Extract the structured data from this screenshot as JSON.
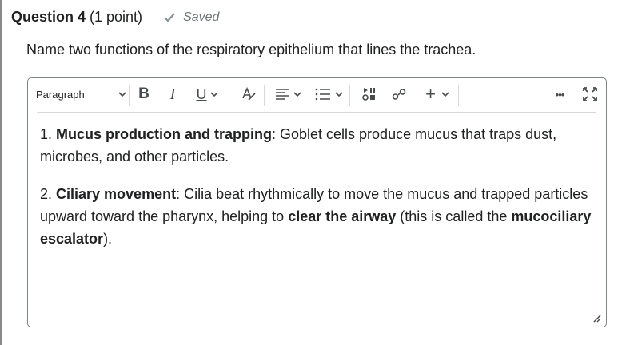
{
  "question": {
    "title": "Question 4",
    "points": "(1 point)",
    "status": "Saved",
    "prompt": "Name two functions of the respiratory epithelium that lines the trachea."
  },
  "toolbar": {
    "format_label": "Paragraph",
    "bold_label": "B",
    "italic_label": "I",
    "underline_label": "U",
    "insert_label": "+",
    "more_label": "•••",
    "icons": [
      "checkmark-icon",
      "chevron-down-icon",
      "text-color-icon",
      "align-icon",
      "list-icon",
      "media-icon",
      "link-icon",
      "plus-icon",
      "more-icon",
      "fullscreen-icon",
      "resize-handle-icon"
    ]
  },
  "answer": {
    "p1_number": "1. ",
    "p1_bold": "Mucus production and trapping",
    "p1_rest": ": Goblet cells produce mucus that traps dust, microbes, and other particles.",
    "p2_number": "2. ",
    "p2_bold": "Ciliary movement",
    "p2_rest_a": ": Cilia beat rhythmically to move the mucus and trapped particles upward toward the pharynx, helping to ",
    "p2_bold_b": "clear the airway",
    "p2_rest_b": " (this is called the ",
    "p2_bold_c": "mucociliary escalator",
    "p2_rest_c": ")."
  },
  "colors": {
    "text": "#202122",
    "muted": "#6e7477",
    "border": "#7f8487",
    "icon": "#494c4e"
  }
}
